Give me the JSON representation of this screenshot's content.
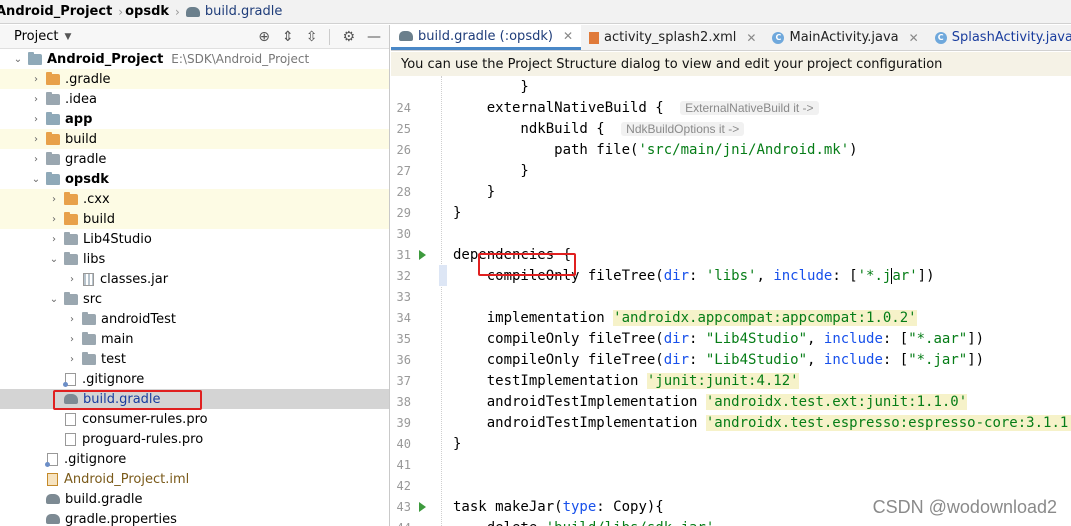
{
  "breadcrumb": {
    "project": "Android_Project",
    "module": "opsdk",
    "file": "build.gradle"
  },
  "project_panel": {
    "title": "Project",
    "tree": [
      {
        "label": "Android_Project",
        "note": "E:\\SDK\\Android_Project",
        "indent": 0,
        "arrow": "open",
        "icon": "folder-bar",
        "bold": true,
        "bg": "none"
      },
      {
        "label": ".gradle",
        "indent": 1,
        "arrow": "closed",
        "icon": "folder-orange",
        "bg": "yellow"
      },
      {
        "label": ".idea",
        "indent": 1,
        "arrow": "closed",
        "icon": "folder-grey",
        "bg": "none"
      },
      {
        "label": "app",
        "indent": 1,
        "arrow": "closed",
        "icon": "folder-bar",
        "bold": true,
        "bg": "none"
      },
      {
        "label": "build",
        "indent": 1,
        "arrow": "closed",
        "icon": "folder-orange",
        "bg": "yellow"
      },
      {
        "label": "gradle",
        "indent": 1,
        "arrow": "closed",
        "icon": "folder-grey",
        "bg": "none"
      },
      {
        "label": "opsdk",
        "indent": 1,
        "arrow": "open",
        "icon": "folder-bar",
        "bold": true,
        "bg": "none"
      },
      {
        "label": ".cxx",
        "indent": 2,
        "arrow": "closed",
        "icon": "folder-orange",
        "bg": "yellow"
      },
      {
        "label": "build",
        "indent": 2,
        "arrow": "closed",
        "icon": "folder-orange",
        "bg": "yellow"
      },
      {
        "label": "Lib4Studio",
        "indent": 2,
        "arrow": "closed",
        "icon": "folder-grey",
        "bg": "none"
      },
      {
        "label": "libs",
        "indent": 2,
        "arrow": "open",
        "icon": "folder-grey",
        "bg": "none"
      },
      {
        "label": "classes.jar",
        "indent": 3,
        "arrow": "closed",
        "icon": "jar",
        "bg": "none"
      },
      {
        "label": "src",
        "indent": 2,
        "arrow": "open",
        "icon": "folder-grey",
        "bg": "none"
      },
      {
        "label": "androidTest",
        "indent": 3,
        "arrow": "closed",
        "icon": "folder-grey",
        "bg": "none"
      },
      {
        "label": "main",
        "indent": 3,
        "arrow": "closed",
        "icon": "folder-grey",
        "bg": "none"
      },
      {
        "label": "test",
        "indent": 3,
        "arrow": "closed",
        "icon": "folder-grey",
        "bg": "none"
      },
      {
        "label": ".gitignore",
        "indent": 2,
        "arrow": "none",
        "icon": "git",
        "bg": "none"
      },
      {
        "label": "build.gradle",
        "indent": 2,
        "arrow": "none",
        "icon": "gradle",
        "bg": "selected",
        "color": "blue"
      },
      {
        "label": "consumer-rules.pro",
        "indent": 2,
        "arrow": "none",
        "icon": "file",
        "bg": "none"
      },
      {
        "label": "proguard-rules.pro",
        "indent": 2,
        "arrow": "none",
        "icon": "file",
        "bg": "none"
      },
      {
        "label": ".gitignore",
        "indent": 1,
        "arrow": "none",
        "icon": "git",
        "bg": "none"
      },
      {
        "label": "Android_Project.iml",
        "indent": 1,
        "arrow": "none",
        "icon": "iml",
        "bg": "none",
        "color": "brown"
      },
      {
        "label": "build.gradle",
        "indent": 1,
        "arrow": "none",
        "icon": "gradle",
        "bg": "none"
      },
      {
        "label": "gradle.properties",
        "indent": 1,
        "arrow": "none",
        "icon": "gradle",
        "bg": "none"
      }
    ]
  },
  "tabs": [
    {
      "label": "build.gradle (:opsdk)",
      "icon": "gradle",
      "active": true
    },
    {
      "label": "activity_splash2.xml",
      "icon": "xml",
      "active": false
    },
    {
      "label": "MainActivity.java",
      "icon": "class",
      "active": false
    },
    {
      "label": "SplashActivity.java",
      "icon": "class",
      "active": false,
      "color": "blue"
    },
    {
      "label": "buil",
      "icon": "gradle",
      "active": false,
      "noclose": true
    }
  ],
  "banner": {
    "text": "You can use the Project Structure dialog to view and edit your project configuration"
  },
  "editor": {
    "lines": [
      {
        "num": "",
        "segs": [
          {
            "t": "        }",
            "c": "kw"
          }
        ]
      },
      {
        "num": "24",
        "segs": [
          {
            "t": "    externalNativeBuild { ",
            "c": "kw"
          },
          {
            "t": "ExternalNativeBuild it ->",
            "c": "hint"
          }
        ]
      },
      {
        "num": "25",
        "segs": [
          {
            "t": "        ndkBuild { ",
            "c": "kw"
          },
          {
            "t": "NdkBuildOptions it ->",
            "c": "hint"
          }
        ]
      },
      {
        "num": "26",
        "segs": [
          {
            "t": "            path file(",
            "c": "kw"
          },
          {
            "t": "'src/main/jni/Android.mk'",
            "c": "str"
          },
          {
            "t": ")",
            "c": "kw"
          }
        ]
      },
      {
        "num": "27",
        "segs": [
          {
            "t": "        }",
            "c": "kw"
          }
        ]
      },
      {
        "num": "28",
        "segs": [
          {
            "t": "    }",
            "c": "kw"
          }
        ]
      },
      {
        "num": "29",
        "segs": [
          {
            "t": "}",
            "c": "kw"
          }
        ]
      },
      {
        "num": "30",
        "segs": []
      },
      {
        "num": "31",
        "run": true,
        "segs": [
          {
            "t": "dependencies {",
            "c": "kw"
          }
        ]
      },
      {
        "num": "32",
        "cursor": true,
        "segs": [
          {
            "t": "    compileOnly fileTree(",
            "c": "kw"
          },
          {
            "t": "dir",
            "c": "param"
          },
          {
            "t": ": ",
            "c": "kw"
          },
          {
            "t": "'libs'",
            "c": "str"
          },
          {
            "t": ", ",
            "c": "kw"
          },
          {
            "t": "include",
            "c": "param"
          },
          {
            "t": ": [",
            "c": "kw"
          },
          {
            "t": "'*.j",
            "c": "str"
          },
          {
            "t": "caret",
            "c": "caret"
          },
          {
            "t": "ar'",
            "c": "str"
          },
          {
            "t": "])",
            "c": "kw"
          }
        ]
      },
      {
        "num": "33",
        "segs": []
      },
      {
        "num": "34",
        "segs": [
          {
            "t": "    implementation ",
            "c": "kw"
          },
          {
            "t": "'androidx.appcompat:appcompat:1.0.2'",
            "c": "str-hl"
          }
        ]
      },
      {
        "num": "35",
        "segs": [
          {
            "t": "    compileOnly fileTree(",
            "c": "kw"
          },
          {
            "t": "dir",
            "c": "param"
          },
          {
            "t": ": ",
            "c": "kw"
          },
          {
            "t": "\"Lib4Studio\"",
            "c": "str"
          },
          {
            "t": ", ",
            "c": "kw"
          },
          {
            "t": "include",
            "c": "param"
          },
          {
            "t": ": [",
            "c": "kw"
          },
          {
            "t": "\"*.aar\"",
            "c": "str"
          },
          {
            "t": "])",
            "c": "kw"
          }
        ]
      },
      {
        "num": "36",
        "segs": [
          {
            "t": "    compileOnly fileTree(",
            "c": "kw"
          },
          {
            "t": "dir",
            "c": "param"
          },
          {
            "t": ": ",
            "c": "kw"
          },
          {
            "t": "\"Lib4Studio\"",
            "c": "str"
          },
          {
            "t": ", ",
            "c": "kw"
          },
          {
            "t": "include",
            "c": "param"
          },
          {
            "t": ": [",
            "c": "kw"
          },
          {
            "t": "\"*.jar\"",
            "c": "str"
          },
          {
            "t": "])",
            "c": "kw"
          }
        ]
      },
      {
        "num": "37",
        "segs": [
          {
            "t": "    testImplementation ",
            "c": "kw"
          },
          {
            "t": "'junit:junit:4.12'",
            "c": "str-hl"
          }
        ]
      },
      {
        "num": "38",
        "segs": [
          {
            "t": "    androidTestImplementation ",
            "c": "kw"
          },
          {
            "t": "'androidx.test.ext:junit:1.1.0'",
            "c": "str-hl"
          }
        ]
      },
      {
        "num": "39",
        "segs": [
          {
            "t": "    androidTestImplementation ",
            "c": "kw"
          },
          {
            "t": "'androidx.test.espresso:espresso-core:3.1.1'",
            "c": "str-hl"
          }
        ]
      },
      {
        "num": "40",
        "segs": [
          {
            "t": "}",
            "c": "kw"
          }
        ]
      },
      {
        "num": "41",
        "segs": []
      },
      {
        "num": "42",
        "segs": []
      },
      {
        "num": "43",
        "run": true,
        "segs": [
          {
            "t": "task makeJar(",
            "c": "kw"
          },
          {
            "t": "type",
            "c": "param"
          },
          {
            "t": ": Copy){",
            "c": "kw"
          }
        ]
      },
      {
        "num": "44",
        "segs": [
          {
            "t": "    delete ",
            "c": "kw"
          },
          {
            "t": "'build/libs/sdk.jar'",
            "c": "str"
          }
        ]
      }
    ]
  },
  "watermark": "CSDN @wodownload2",
  "accent_colors": {
    "highlight_box": "#e02020",
    "active_tab": "#4a88c7",
    "string": "#067d17"
  }
}
